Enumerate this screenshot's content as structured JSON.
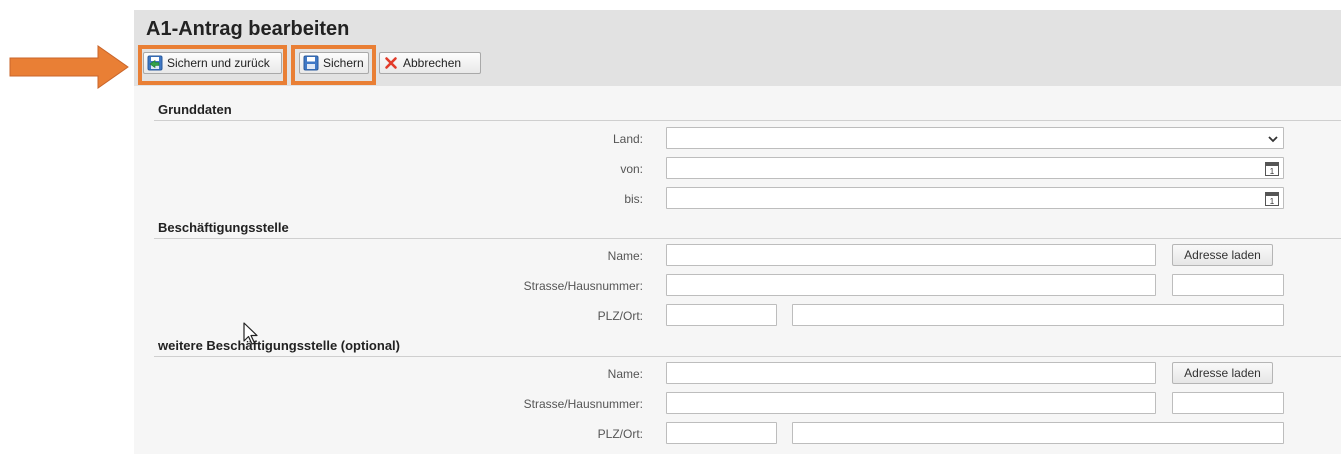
{
  "page": {
    "title": "A1-Antrag bearbeiten"
  },
  "toolbar": {
    "save_back_label": "Sichern und zurück",
    "save_label": "Sichern",
    "cancel_label": "Abbrechen"
  },
  "grunddaten": {
    "heading": "Grunddaten",
    "land_label": "Land:",
    "land_value": "",
    "von_label": "von:",
    "von_value": "",
    "bis_label": "bis:",
    "bis_value": ""
  },
  "beschaeftigung": {
    "heading": "Beschäftigungsstelle",
    "name_label": "Name:",
    "name_value": "",
    "load_address_label": "Adresse laden",
    "street_label": "Strasse/Hausnummer:",
    "street_value": "",
    "house_number_value": "",
    "plz_label": "PLZ/Ort:",
    "plz_value": "",
    "ort_value": ""
  },
  "weitere_beschaeftigung": {
    "heading": "weitere Beschäftigungsstelle (optional)",
    "name_label": "Name:",
    "name_value": "",
    "load_address_label": "Adresse laden",
    "street_label": "Strasse/Hausnummer:",
    "street_value": "",
    "house_number_value": "",
    "plz_label": "PLZ/Ort:",
    "plz_value": "",
    "ort_value": ""
  },
  "colors": {
    "highlight": "#e97f35",
    "header_bg": "#e2e2e2",
    "panel_bg": "#f6f6f6"
  },
  "icons": {
    "save_back": "save-and-back-icon",
    "save": "floppy-disk-icon",
    "cancel": "red-x-icon",
    "dropdown": "chevron-down-icon",
    "calendar": "calendar-icon"
  }
}
